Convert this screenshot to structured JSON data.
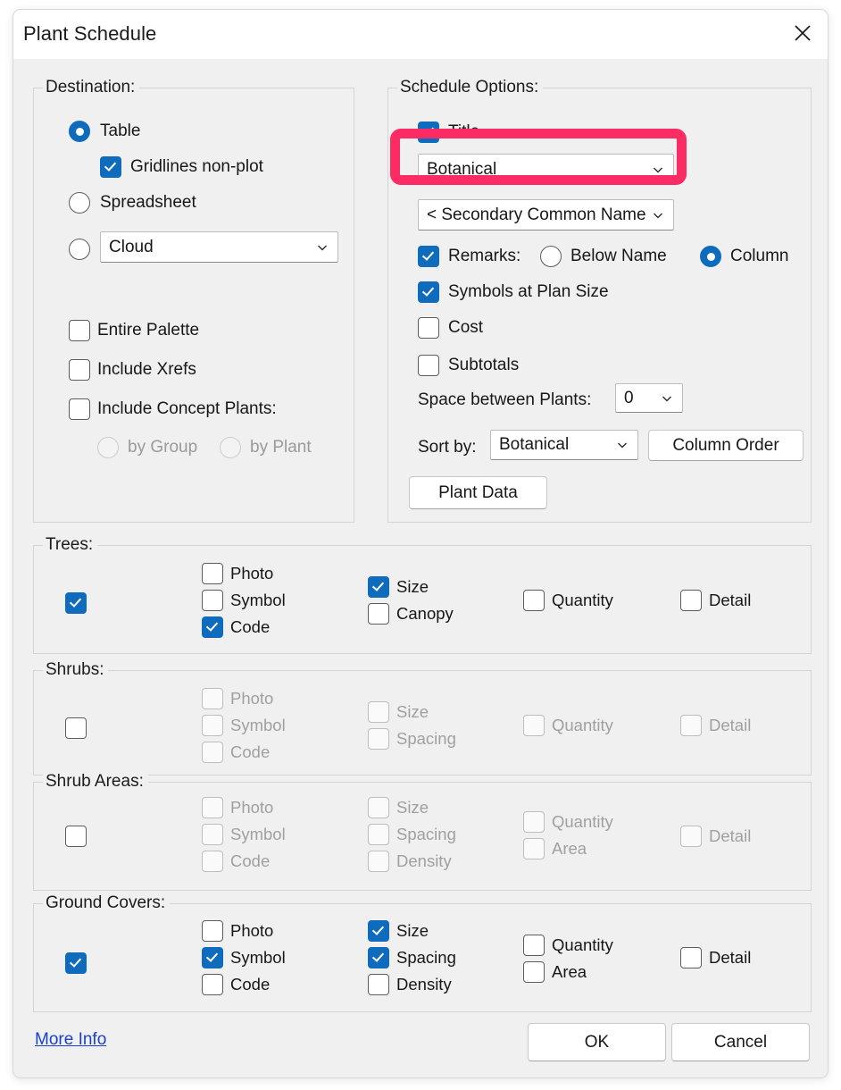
{
  "window": {
    "title": "Plant Schedule",
    "close_icon": "close-icon"
  },
  "destination": {
    "legend": "Destination:",
    "options": [
      {
        "label": "Table",
        "checked": true
      },
      {
        "label": "Spreadsheet",
        "checked": false
      },
      {
        "label": "",
        "checked": false
      }
    ],
    "gridlines": {
      "label": "Gridlines non-plot",
      "checked": true
    },
    "cloud_combo": {
      "value": "Cloud"
    },
    "checks": [
      {
        "label": "Entire Palette",
        "checked": false
      },
      {
        "label": "Include Xrefs",
        "checked": false
      },
      {
        "label": "Include Concept Plants:",
        "checked": false
      }
    ],
    "concept_radios": [
      {
        "label": "by Group",
        "checked": false,
        "disabled": true
      },
      {
        "label": "by Plant",
        "checked": false,
        "disabled": true
      }
    ]
  },
  "schedule_options": {
    "legend": "Schedule Options:",
    "title_check": {
      "label": "Title",
      "checked": true
    },
    "name_combo": {
      "value": "Botanical"
    },
    "secondary_combo": {
      "value": "< Secondary Common Name"
    },
    "remarks": {
      "label": "Remarks:",
      "checked": true,
      "radios": [
        {
          "label": "Below Name",
          "checked": false
        },
        {
          "label": "Column",
          "checked": true
        }
      ]
    },
    "symbols_at_plan_size": {
      "label": "Symbols at Plan Size",
      "checked": true
    },
    "cost": {
      "label": "Cost",
      "checked": false
    },
    "subtotals": {
      "label": "Subtotals",
      "checked": false
    },
    "space_between": {
      "label": "Space between Plants:",
      "value": "0"
    },
    "sort_by": {
      "label": "Sort by:",
      "value": "Botanical"
    },
    "column_order_button": "Column Order",
    "plant_data_button": "Plant Data"
  },
  "plant_groups": [
    {
      "legend": "Trees:",
      "master": {
        "checked": true,
        "disabled": false
      },
      "disabled": false,
      "col1": [
        {
          "label": "Photo",
          "checked": false
        },
        {
          "label": "Symbol",
          "checked": false
        },
        {
          "label": "Code",
          "checked": true
        }
      ],
      "col2": [
        {
          "label": "Size",
          "checked": true
        },
        {
          "label": "Canopy",
          "checked": false
        }
      ],
      "col3": [
        {
          "label": "Quantity",
          "checked": false
        }
      ],
      "col4": [
        {
          "label": "Detail",
          "checked": false
        }
      ]
    },
    {
      "legend": "Shrubs:",
      "master": {
        "checked": false,
        "disabled": false
      },
      "disabled": true,
      "col1": [
        {
          "label": "Photo",
          "checked": false
        },
        {
          "label": "Symbol",
          "checked": false
        },
        {
          "label": "Code",
          "checked": false
        }
      ],
      "col2": [
        {
          "label": "Size",
          "checked": false
        },
        {
          "label": "Spacing",
          "checked": false
        }
      ],
      "col3": [
        {
          "label": "Quantity",
          "checked": false
        }
      ],
      "col4": [
        {
          "label": "Detail",
          "checked": false
        }
      ]
    },
    {
      "legend": "Shrub Areas:",
      "master": {
        "checked": false,
        "disabled": false
      },
      "disabled": true,
      "col1": [
        {
          "label": "Photo",
          "checked": false
        },
        {
          "label": "Symbol",
          "checked": false
        },
        {
          "label": "Code",
          "checked": false
        }
      ],
      "col2": [
        {
          "label": "Size",
          "checked": false
        },
        {
          "label": "Spacing",
          "checked": false
        },
        {
          "label": "Density",
          "checked": false
        }
      ],
      "col3": [
        {
          "label": "Quantity",
          "checked": false
        },
        {
          "label": "Area",
          "checked": false
        }
      ],
      "col4": [
        {
          "label": "Detail",
          "checked": false
        }
      ]
    },
    {
      "legend": "Ground Covers:",
      "master": {
        "checked": true,
        "disabled": false
      },
      "disabled": false,
      "col1": [
        {
          "label": "Photo",
          "checked": false
        },
        {
          "label": "Symbol",
          "checked": true
        },
        {
          "label": "Code",
          "checked": false
        }
      ],
      "col2": [
        {
          "label": "Size",
          "checked": true
        },
        {
          "label": "Spacing",
          "checked": true
        },
        {
          "label": "Density",
          "checked": false
        }
      ],
      "col3": [
        {
          "label": "Quantity",
          "checked": false
        },
        {
          "label": "Area",
          "checked": false
        }
      ],
      "col4": [
        {
          "label": "Detail",
          "checked": false
        }
      ]
    }
  ],
  "footer": {
    "more_info": "More Info",
    "ok": "OK",
    "cancel": "Cancel"
  },
  "annotation": {
    "color": "#fb2b63",
    "target": "name_combo"
  },
  "colors": {
    "accent_blue": "#0f6cbd",
    "dialog_bg": "#f0f0f0",
    "titlebar_bg": "#ffffff",
    "link": "#1a42c8",
    "highlight_pink": "#fb2b63"
  }
}
